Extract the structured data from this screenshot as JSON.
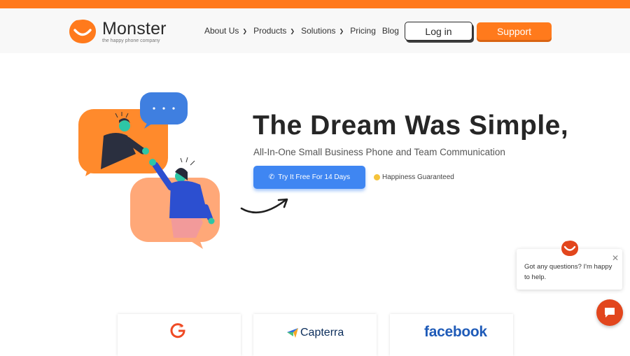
{
  "brand": {
    "name": "Monster",
    "tagline": "the happy phone company",
    "accent_color": "#ff7a1c"
  },
  "nav": {
    "items": [
      {
        "label": "About Us",
        "has_dropdown": true
      },
      {
        "label": "Products",
        "has_dropdown": true
      },
      {
        "label": "Solutions",
        "has_dropdown": true
      },
      {
        "label": "Pricing",
        "has_dropdown": false
      },
      {
        "label": "Blog",
        "has_dropdown": false
      }
    ],
    "login_label": "Log in",
    "support_label": "Support"
  },
  "hero": {
    "title": "The Dream Was Simple,",
    "subtitle": "All-In-One Small Business Phone and Team Communication",
    "cta_label": "Try It Free For 14 Days",
    "cta_color": "#3f86f2",
    "guarantee": "Happiness Guaranteed",
    "illustration_icon": "chat-people-illustration"
  },
  "chat_widget": {
    "message": "Got any questions? I'm happy to help.",
    "launcher_color": "#e2461d"
  },
  "review_badges": [
    {
      "name": "G2",
      "icon": "g2-logo"
    },
    {
      "name": "Capterra",
      "icon": "capterra-logo"
    },
    {
      "name": "facebook",
      "icon": "facebook-logo"
    }
  ]
}
